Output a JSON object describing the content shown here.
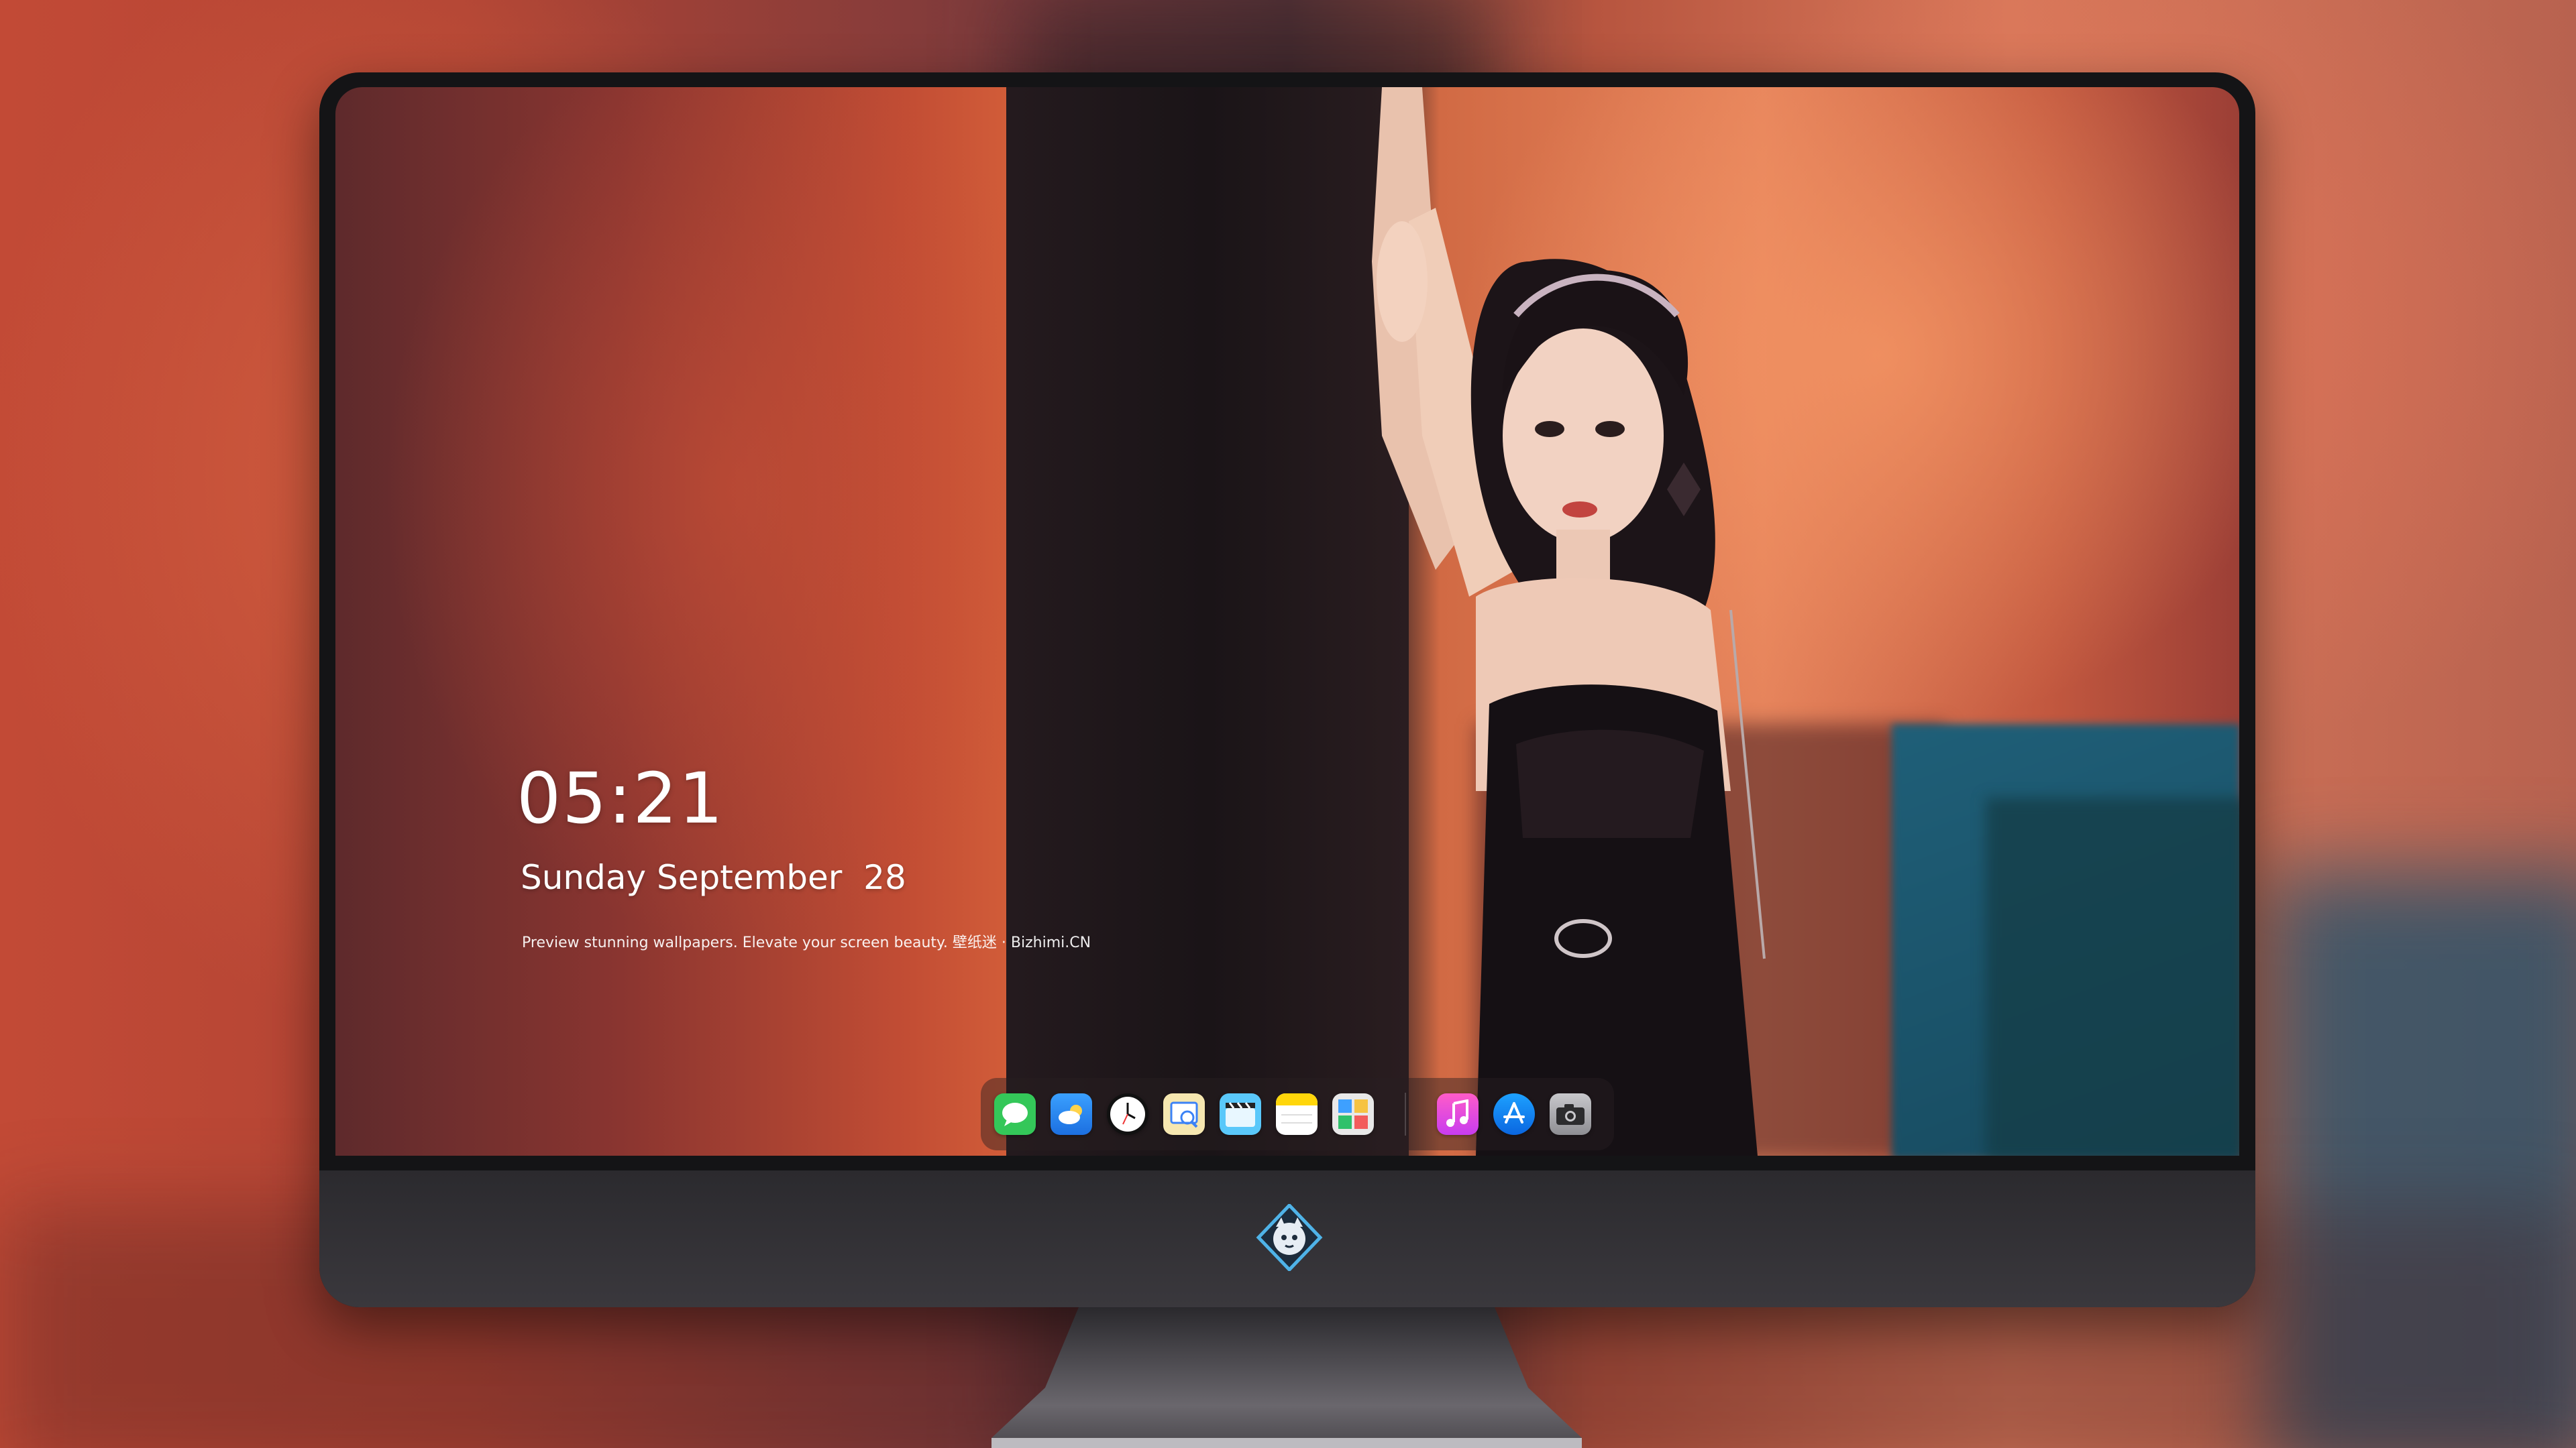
{
  "lockscreen": {
    "time": "05:21",
    "date": "Sunday September  28",
    "tagline": "Preview stunning wallpapers. Elevate your screen beauty. 壁纸迷 · Bizhimi.CN"
  },
  "dock": {
    "apps": [
      {
        "name": "messages-icon",
        "color": "#34c759"
      },
      {
        "name": "weather-icon",
        "color": "#1e90ff"
      },
      {
        "name": "clock-icon",
        "color": "#ffffff"
      },
      {
        "name": "preview-icon",
        "color": "#f4c542"
      },
      {
        "name": "video-editor-icon",
        "color": "#5ac8fa"
      },
      {
        "name": "notes-icon",
        "color": "#ffd60a"
      },
      {
        "name": "photos-icon",
        "color": "#e5e5e5"
      },
      {
        "name": "music-icon",
        "color": "#ff2d8a"
      },
      {
        "name": "app-store-icon",
        "color": "#0a84ff"
      },
      {
        "name": "camera-icon",
        "color": "#8e8e93"
      }
    ]
  },
  "monitor": {
    "chin_logo": "mascot-logo-icon"
  }
}
